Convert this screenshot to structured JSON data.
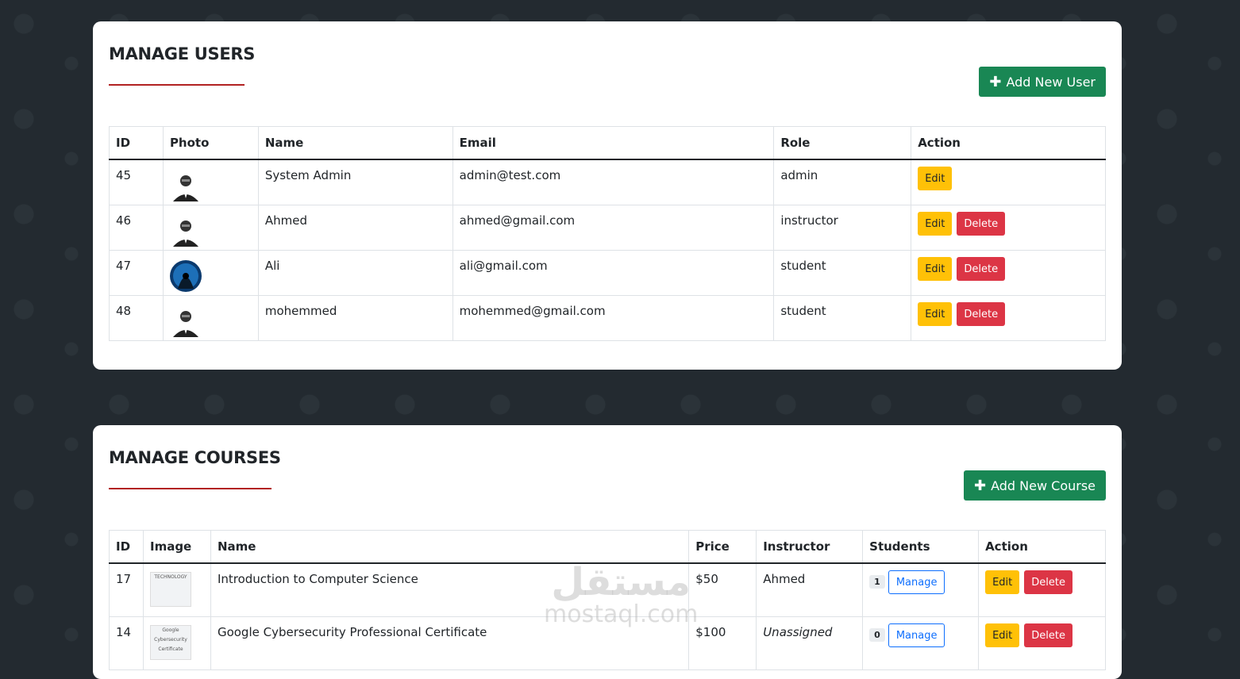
{
  "users": {
    "title": "MANAGE USERS",
    "add_button": "Add New User",
    "columns": [
      "ID",
      "Photo",
      "Name",
      "Email",
      "Role",
      "Action"
    ],
    "rows": [
      {
        "id": "45",
        "name": "System Admin",
        "email": "admin@test.com",
        "role": "admin",
        "photo": "default-avatar-icon",
        "can_delete": false
      },
      {
        "id": "46",
        "name": "Ahmed",
        "email": "ahmed@gmail.com",
        "role": "instructor",
        "photo": "default-avatar-icon",
        "can_delete": true
      },
      {
        "id": "47",
        "name": "Ali",
        "email": "ali@gmail.com",
        "role": "student",
        "photo": "hooded-hacker-avatar",
        "can_delete": true
      },
      {
        "id": "48",
        "name": "mohemmed",
        "email": "mohemmed@gmail.com",
        "role": "student",
        "photo": "default-avatar-icon",
        "can_delete": true
      }
    ],
    "edit_label": "Edit",
    "delete_label": "Delete"
  },
  "courses": {
    "title": "MANAGE COURSES",
    "add_button": "Add New Course",
    "columns": [
      "ID",
      "Image",
      "Name",
      "Price",
      "Instructor",
      "Students",
      "Action"
    ],
    "rows": [
      {
        "id": "17",
        "name": "Introduction to Computer Science",
        "price": "$50",
        "instructor": "Ahmed",
        "instructor_assigned": true,
        "students": "1",
        "image_text": "TECHNOLOGY"
      },
      {
        "id": "14",
        "name": "Google Cybersecurity Professional Certificate",
        "price": "$100",
        "instructor": "Unassigned",
        "instructor_assigned": false,
        "students": "0",
        "image_text": "Google Cybersecurity Certificate"
      }
    ],
    "manage_label": "Manage",
    "edit_label": "Edit",
    "delete_label": "Delete"
  },
  "watermark": {
    "arabic": "مستقل",
    "latin": "mostaql.com"
  },
  "colors": {
    "success": "#198754",
    "warning": "#ffc107",
    "danger": "#dc3545",
    "primary": "#0d6efd",
    "accent_line": "#b22222",
    "background": "#232a30"
  }
}
